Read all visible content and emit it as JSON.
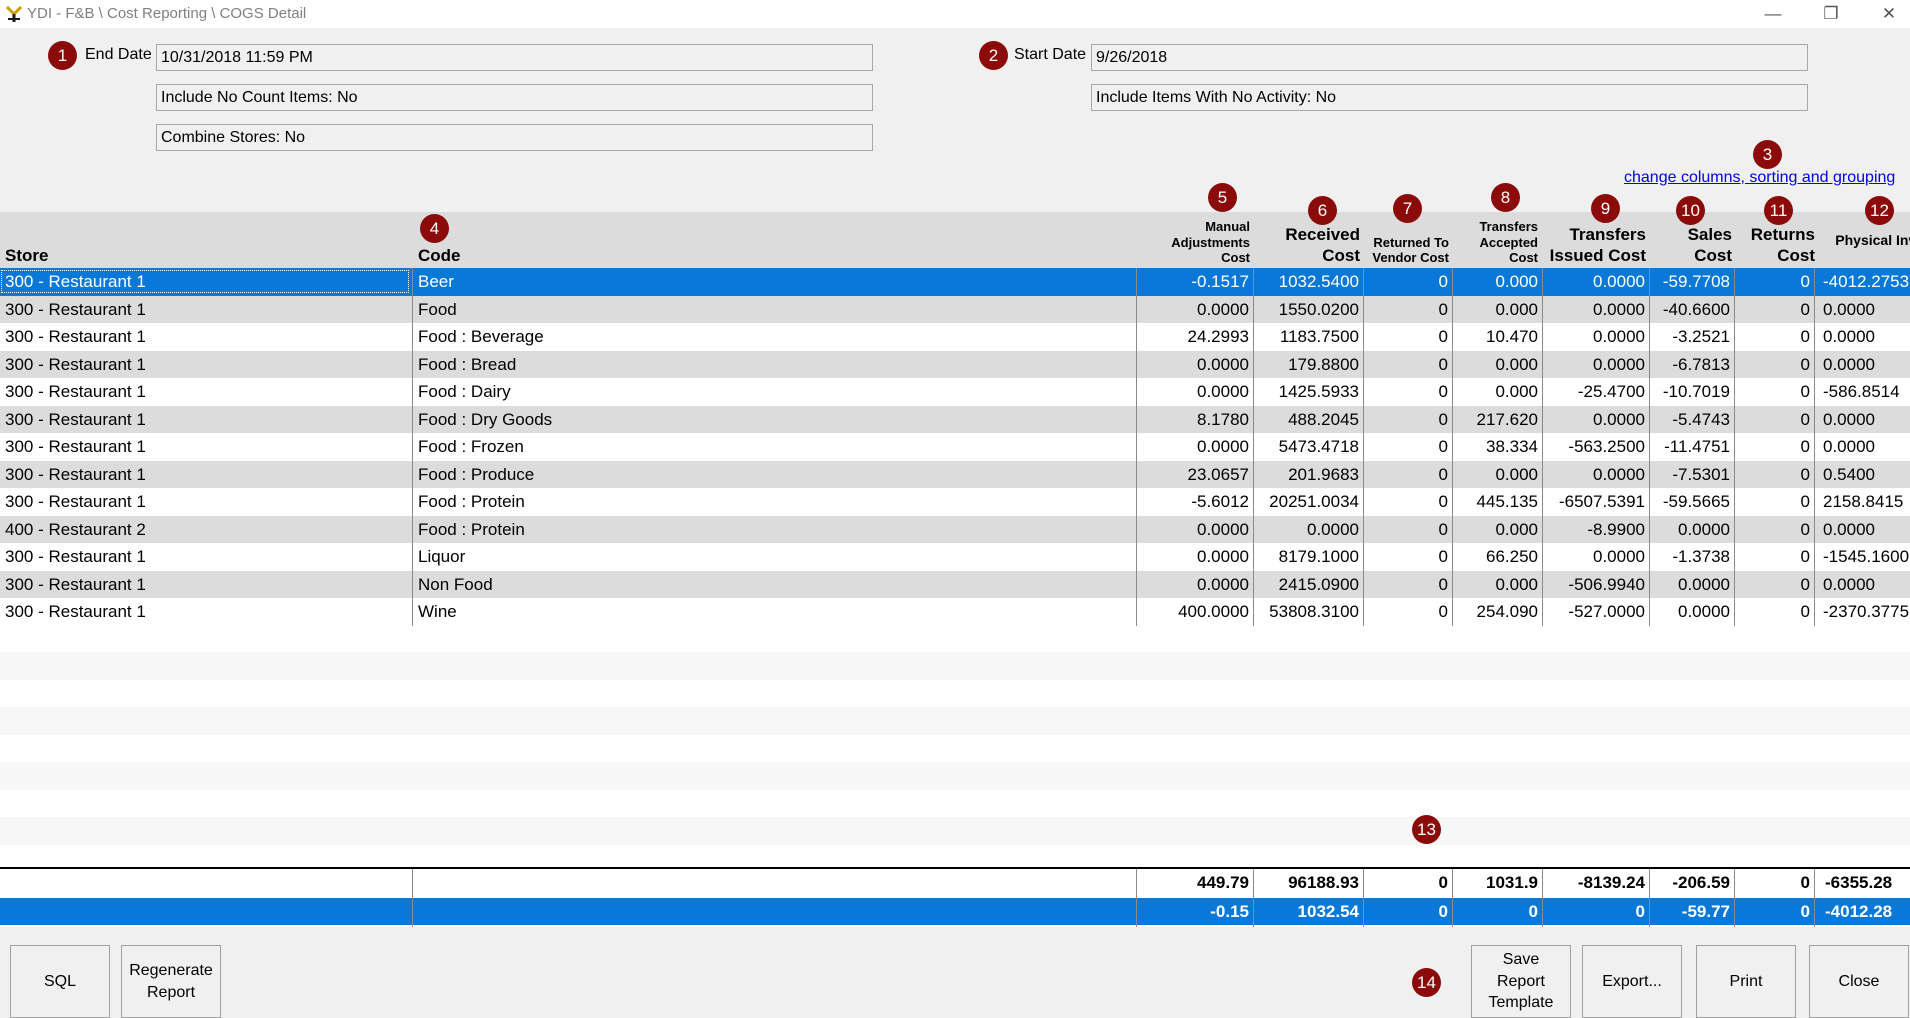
{
  "window": {
    "title": "YDI - F&B \\ Cost Reporting \\ COGS Detail",
    "min": "—",
    "max": "❐",
    "close": "✕"
  },
  "params": {
    "end_date_label": "End Date",
    "end_date_value": "10/31/2018 11:59 PM",
    "start_date_label": "Start Date",
    "start_date_value": "9/26/2018",
    "include_no_count": "Include No Count Items: No",
    "include_no_activity": "Include Items With No Activity: No",
    "combine_stores": "Combine Stores: No"
  },
  "change_link": "change columns, sorting and grouping",
  "badges": [
    "1",
    "2",
    "3",
    "4",
    "5",
    "6",
    "7",
    "8",
    "9",
    "10",
    "11",
    "12",
    "13",
    "14"
  ],
  "columns": {
    "store": "Store",
    "code": "Code",
    "manual_adj": "Manual Adjustments Cost",
    "received": "Received Cost",
    "returned": "Returned To Vendor Cost",
    "transfers_accepted": "Transfers Accepted Cost",
    "transfers_issued": "Transfers Issued Cost",
    "sales": "Sales Cost",
    "returns": "Returns Cost",
    "physical": "Physical Inventory Cost"
  },
  "rows": [
    {
      "store": "300 - Restaurant 1",
      "code": "Beer",
      "manual": "-0.1517",
      "received": "1032.5400",
      "returned": "0",
      "accepted": "0.000",
      "issued": "0.0000",
      "sales": "-59.7708",
      "returns": "0",
      "physical": "-4012.2753"
    },
    {
      "store": "300 - Restaurant 1",
      "code": "Food",
      "manual": "0.0000",
      "received": "1550.0200",
      "returned": "0",
      "accepted": "0.000",
      "issued": "0.0000",
      "sales": "-40.6600",
      "returns": "0",
      "physical": "0.0000"
    },
    {
      "store": "300 - Restaurant 1",
      "code": "Food : Beverage",
      "manual": "24.2993",
      "received": "1183.7500",
      "returned": "0",
      "accepted": "10.470",
      "issued": "0.0000",
      "sales": "-3.2521",
      "returns": "0",
      "physical": "0.0000"
    },
    {
      "store": "300 - Restaurant 1",
      "code": "Food : Bread",
      "manual": "0.0000",
      "received": "179.8800",
      "returned": "0",
      "accepted": "0.000",
      "issued": "0.0000",
      "sales": "-6.7813",
      "returns": "0",
      "physical": "0.0000"
    },
    {
      "store": "300 - Restaurant 1",
      "code": "Food : Dairy",
      "manual": "0.0000",
      "received": "1425.5933",
      "returned": "0",
      "accepted": "0.000",
      "issued": "-25.4700",
      "sales": "-10.7019",
      "returns": "0",
      "physical": "-586.8514"
    },
    {
      "store": "300 - Restaurant 1",
      "code": "Food : Dry Goods",
      "manual": "8.1780",
      "received": "488.2045",
      "returned": "0",
      "accepted": "217.620",
      "issued": "0.0000",
      "sales": "-5.4743",
      "returns": "0",
      "physical": "0.0000"
    },
    {
      "store": "300 - Restaurant 1",
      "code": "Food : Frozen",
      "manual": "0.0000",
      "received": "5473.4718",
      "returned": "0",
      "accepted": "38.334",
      "issued": "-563.2500",
      "sales": "-11.4751",
      "returns": "0",
      "physical": "0.0000"
    },
    {
      "store": "300 - Restaurant 1",
      "code": "Food : Produce",
      "manual": "23.0657",
      "received": "201.9683",
      "returned": "0",
      "accepted": "0.000",
      "issued": "0.0000",
      "sales": "-7.5301",
      "returns": "0",
      "physical": "0.5400"
    },
    {
      "store": "300 - Restaurant 1",
      "code": "Food : Protein",
      "manual": "-5.6012",
      "received": "20251.0034",
      "returned": "0",
      "accepted": "445.135",
      "issued": "-6507.5391",
      "sales": "-59.5665",
      "returns": "0",
      "physical": "2158.8415"
    },
    {
      "store": "400 - Restaurant 2",
      "code": "Food : Protein",
      "manual": "0.0000",
      "received": "0.0000",
      "returned": "0",
      "accepted": "0.000",
      "issued": "-8.9900",
      "sales": "0.0000",
      "returns": "0",
      "physical": "0.0000"
    },
    {
      "store": "300 - Restaurant 1",
      "code": "Liquor",
      "manual": "0.0000",
      "received": "8179.1000",
      "returned": "0",
      "accepted": "66.250",
      "issued": "0.0000",
      "sales": "-1.3738",
      "returns": "0",
      "physical": "-1545.1600"
    },
    {
      "store": "300 - Restaurant 1",
      "code": "Non Food",
      "manual": "0.0000",
      "received": "2415.0900",
      "returned": "0",
      "accepted": "0.000",
      "issued": "-506.9940",
      "sales": "0.0000",
      "returns": "0",
      "physical": "0.0000"
    },
    {
      "store": "300 - Restaurant 1",
      "code": "Wine",
      "manual": "400.0000",
      "received": "53808.3100",
      "returned": "0",
      "accepted": "254.090",
      "issued": "-527.0000",
      "sales": "0.0000",
      "returns": "0",
      "physical": "-2370.3775"
    }
  ],
  "totals": [
    {
      "manual": "449.79",
      "received": "96188.93",
      "returned": "0",
      "accepted": "1031.9",
      "issued": "-8139.24",
      "sales": "-206.59",
      "returns": "0",
      "physical": "-6355.28"
    },
    {
      "manual": "-0.15",
      "received": "1032.54",
      "returned": "0",
      "accepted": "0",
      "issued": "0",
      "sales": "-59.77",
      "returns": "0",
      "physical": "-4012.28"
    }
  ],
  "buttons": {
    "sql": "SQL",
    "regenerate": "Regenerate\nReport",
    "save_template": "Save\nReport\nTemplate",
    "export": "Export...",
    "print": "Print",
    "close": "Close"
  },
  "colors": {
    "selection": "#0a78d7",
    "badge": "#8b0a0a",
    "link": "#0000ee"
  }
}
